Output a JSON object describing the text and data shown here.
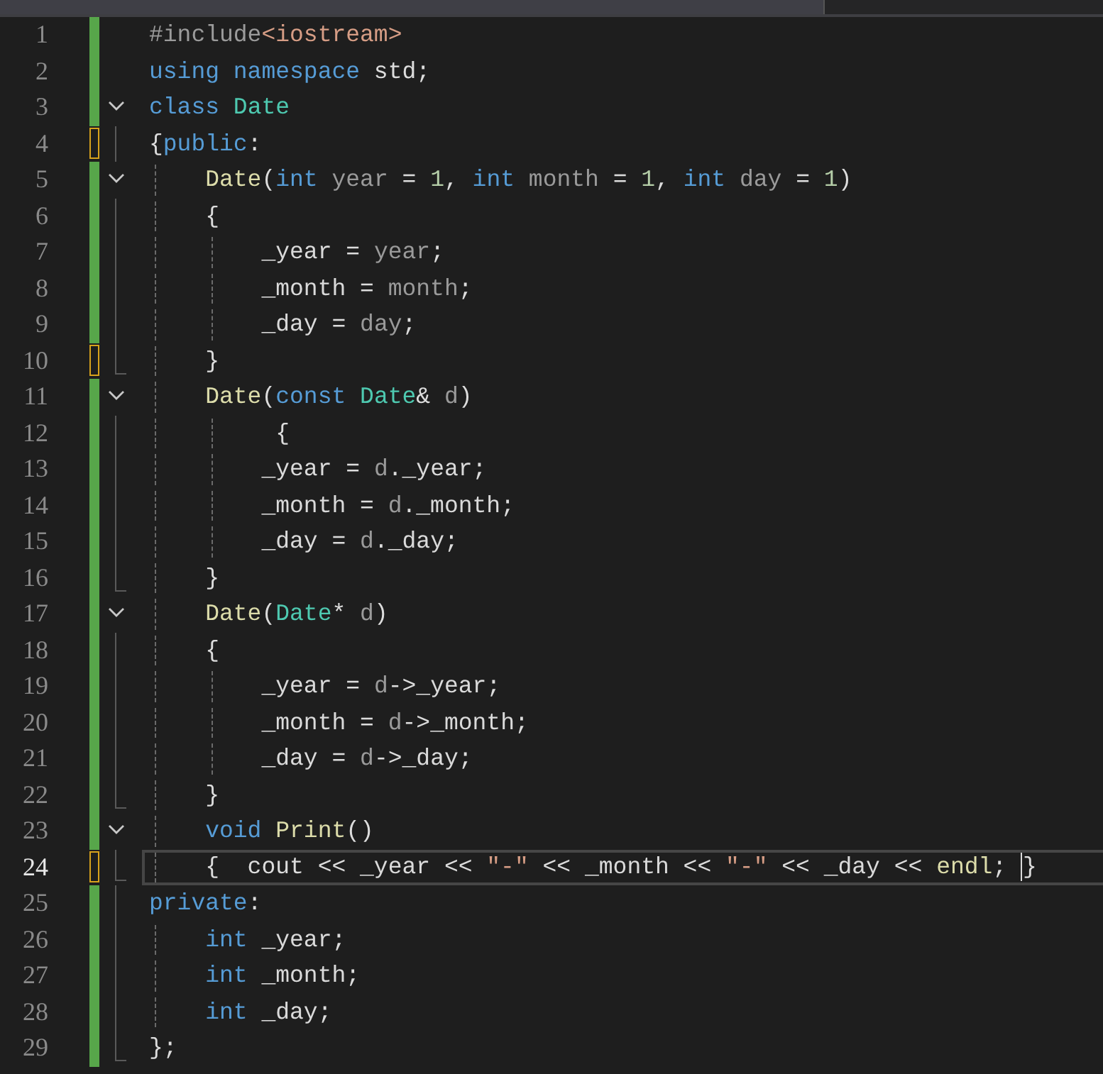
{
  "lines": [
    {
      "number": "1",
      "unsaved": false,
      "foldable": false,
      "in_region": false,
      "region_end": false,
      "current": false,
      "tokens": [
        {
          "kind": "pre",
          "text": "#include"
        },
        {
          "kind": "str",
          "text": "<iostream>"
        }
      ]
    },
    {
      "number": "2",
      "unsaved": false,
      "foldable": false,
      "in_region": false,
      "region_end": false,
      "current": false,
      "tokens": [
        {
          "kind": "kw",
          "text": "using namespace"
        },
        {
          "kind": "plain",
          "text": " std;"
        }
      ]
    },
    {
      "number": "3",
      "unsaved": false,
      "foldable": true,
      "in_region": false,
      "region_end": false,
      "current": false,
      "tokens": [
        {
          "kind": "kw",
          "text": "class"
        },
        {
          "kind": "type",
          "text": " Date"
        }
      ]
    },
    {
      "number": "4",
      "unsaved": true,
      "foldable": false,
      "in_region": true,
      "region_end": false,
      "current": false,
      "tokens": [
        {
          "kind": "plain",
          "text": "{"
        },
        {
          "kind": "kw",
          "text": "public"
        },
        {
          "kind": "plain",
          "text": ":"
        }
      ]
    },
    {
      "number": "5",
      "unsaved": false,
      "foldable": true,
      "in_region": false,
      "region_end": false,
      "current": false,
      "tokens": [
        {
          "kind": "fn",
          "text": "    Date"
        },
        {
          "kind": "plain",
          "text": "("
        },
        {
          "kind": "kw",
          "text": "int"
        },
        {
          "kind": "param",
          "text": " year"
        },
        {
          "kind": "plain",
          "text": " = "
        },
        {
          "kind": "num",
          "text": "1"
        },
        {
          "kind": "plain",
          "text": ", "
        },
        {
          "kind": "kw",
          "text": "int"
        },
        {
          "kind": "param",
          "text": " month"
        },
        {
          "kind": "plain",
          "text": " = "
        },
        {
          "kind": "num",
          "text": "1"
        },
        {
          "kind": "plain",
          "text": ", "
        },
        {
          "kind": "kw",
          "text": "int"
        },
        {
          "kind": "param",
          "text": " day"
        },
        {
          "kind": "plain",
          "text": " = "
        },
        {
          "kind": "num",
          "text": "1"
        },
        {
          "kind": "plain",
          "text": ")"
        }
      ]
    },
    {
      "number": "6",
      "unsaved": false,
      "foldable": false,
      "in_region": true,
      "region_end": false,
      "current": false,
      "tokens": [
        {
          "kind": "plain",
          "text": "    {"
        }
      ]
    },
    {
      "number": "7",
      "unsaved": false,
      "foldable": false,
      "in_region": true,
      "region_end": false,
      "current": false,
      "tokens": [
        {
          "kind": "member",
          "text": "        _year"
        },
        {
          "kind": "plain",
          "text": " = "
        },
        {
          "kind": "param",
          "text": "year"
        },
        {
          "kind": "plain",
          "text": ";"
        }
      ]
    },
    {
      "number": "8",
      "unsaved": false,
      "foldable": false,
      "in_region": true,
      "region_end": false,
      "current": false,
      "tokens": [
        {
          "kind": "member",
          "text": "        _month"
        },
        {
          "kind": "plain",
          "text": " = "
        },
        {
          "kind": "param",
          "text": "month"
        },
        {
          "kind": "plain",
          "text": ";"
        }
      ]
    },
    {
      "number": "9",
      "unsaved": false,
      "foldable": false,
      "in_region": true,
      "region_end": false,
      "current": false,
      "tokens": [
        {
          "kind": "member",
          "text": "        _day"
        },
        {
          "kind": "plain",
          "text": " = "
        },
        {
          "kind": "param",
          "text": "day"
        },
        {
          "kind": "plain",
          "text": ";"
        }
      ]
    },
    {
      "number": "10",
      "unsaved": true,
      "foldable": false,
      "in_region": true,
      "region_end": true,
      "current": false,
      "tokens": [
        {
          "kind": "plain",
          "text": "    }"
        }
      ]
    },
    {
      "number": "11",
      "unsaved": false,
      "foldable": true,
      "in_region": false,
      "region_end": false,
      "current": false,
      "tokens": [
        {
          "kind": "fn",
          "text": "    Date"
        },
        {
          "kind": "plain",
          "text": "("
        },
        {
          "kind": "kw",
          "text": "const"
        },
        {
          "kind": "type",
          "text": " Date"
        },
        {
          "kind": "plain",
          "text": "&"
        },
        {
          "kind": "param",
          "text": " d"
        },
        {
          "kind": "plain",
          "text": ")"
        }
      ]
    },
    {
      "number": "12",
      "unsaved": false,
      "foldable": false,
      "in_region": true,
      "region_end": false,
      "current": false,
      "tokens": [
        {
          "kind": "plain",
          "text": "         {"
        }
      ]
    },
    {
      "number": "13",
      "unsaved": false,
      "foldable": false,
      "in_region": true,
      "region_end": false,
      "current": false,
      "tokens": [
        {
          "kind": "member",
          "text": "        _year"
        },
        {
          "kind": "plain",
          "text": " = "
        },
        {
          "kind": "param",
          "text": "d"
        },
        {
          "kind": "plain",
          "text": "."
        },
        {
          "kind": "member",
          "text": "_year"
        },
        {
          "kind": "plain",
          "text": ";"
        }
      ]
    },
    {
      "number": "14",
      "unsaved": false,
      "foldable": false,
      "in_region": true,
      "region_end": false,
      "current": false,
      "tokens": [
        {
          "kind": "member",
          "text": "        _month"
        },
        {
          "kind": "plain",
          "text": " = "
        },
        {
          "kind": "param",
          "text": "d"
        },
        {
          "kind": "plain",
          "text": "."
        },
        {
          "kind": "member",
          "text": "_month"
        },
        {
          "kind": "plain",
          "text": ";"
        }
      ]
    },
    {
      "number": "15",
      "unsaved": false,
      "foldable": false,
      "in_region": true,
      "region_end": false,
      "current": false,
      "tokens": [
        {
          "kind": "member",
          "text": "        _day"
        },
        {
          "kind": "plain",
          "text": " = "
        },
        {
          "kind": "param",
          "text": "d"
        },
        {
          "kind": "plain",
          "text": "."
        },
        {
          "kind": "member",
          "text": "_day"
        },
        {
          "kind": "plain",
          "text": ";"
        }
      ]
    },
    {
      "number": "16",
      "unsaved": false,
      "foldable": false,
      "in_region": true,
      "region_end": true,
      "current": false,
      "tokens": [
        {
          "kind": "plain",
          "text": "    }"
        }
      ]
    },
    {
      "number": "17",
      "unsaved": false,
      "foldable": true,
      "in_region": false,
      "region_end": false,
      "current": false,
      "tokens": [
        {
          "kind": "fn",
          "text": "    Date"
        },
        {
          "kind": "plain",
          "text": "("
        },
        {
          "kind": "type",
          "text": "Date"
        },
        {
          "kind": "plain",
          "text": "*"
        },
        {
          "kind": "param",
          "text": " d"
        },
        {
          "kind": "plain",
          "text": ")"
        }
      ]
    },
    {
      "number": "18",
      "unsaved": false,
      "foldable": false,
      "in_region": true,
      "region_end": false,
      "current": false,
      "tokens": [
        {
          "kind": "plain",
          "text": "    {"
        }
      ]
    },
    {
      "number": "19",
      "unsaved": false,
      "foldable": false,
      "in_region": true,
      "region_end": false,
      "current": false,
      "tokens": [
        {
          "kind": "member",
          "text": "        _year"
        },
        {
          "kind": "plain",
          "text": " = "
        },
        {
          "kind": "param",
          "text": "d"
        },
        {
          "kind": "plain",
          "text": "->"
        },
        {
          "kind": "member",
          "text": "_year"
        },
        {
          "kind": "plain",
          "text": ";"
        }
      ]
    },
    {
      "number": "20",
      "unsaved": false,
      "foldable": false,
      "in_region": true,
      "region_end": false,
      "current": false,
      "tokens": [
        {
          "kind": "member",
          "text": "        _month"
        },
        {
          "kind": "plain",
          "text": " = "
        },
        {
          "kind": "param",
          "text": "d"
        },
        {
          "kind": "plain",
          "text": "->"
        },
        {
          "kind": "member",
          "text": "_month"
        },
        {
          "kind": "plain",
          "text": ";"
        }
      ]
    },
    {
      "number": "21",
      "unsaved": false,
      "foldable": false,
      "in_region": true,
      "region_end": false,
      "current": false,
      "tokens": [
        {
          "kind": "member",
          "text": "        _day"
        },
        {
          "kind": "plain",
          "text": " = "
        },
        {
          "kind": "param",
          "text": "d"
        },
        {
          "kind": "plain",
          "text": "->"
        },
        {
          "kind": "member",
          "text": "_day"
        },
        {
          "kind": "plain",
          "text": ";"
        }
      ]
    },
    {
      "number": "22",
      "unsaved": false,
      "foldable": false,
      "in_region": true,
      "region_end": true,
      "current": false,
      "tokens": [
        {
          "kind": "plain",
          "text": "    }"
        }
      ]
    },
    {
      "number": "23",
      "unsaved": false,
      "foldable": true,
      "in_region": false,
      "region_end": false,
      "current": false,
      "tokens": [
        {
          "kind": "kw",
          "text": "    void"
        },
        {
          "kind": "fn",
          "text": " Print"
        },
        {
          "kind": "plain",
          "text": "()"
        }
      ]
    },
    {
      "number": "24",
      "unsaved": true,
      "foldable": false,
      "in_region": true,
      "region_end": true,
      "current": true,
      "tokens": [
        {
          "kind": "plain",
          "text": "    {  cout << "
        },
        {
          "kind": "member",
          "text": "_year"
        },
        {
          "kind": "plain",
          "text": " << "
        },
        {
          "kind": "str",
          "text": "\"-\""
        },
        {
          "kind": "plain",
          "text": " << "
        },
        {
          "kind": "member",
          "text": "_month"
        },
        {
          "kind": "plain",
          "text": " << "
        },
        {
          "kind": "str",
          "text": "\"-\""
        },
        {
          "kind": "plain",
          "text": " << "
        },
        {
          "kind": "member",
          "text": "_day"
        },
        {
          "kind": "plain",
          "text": " << "
        },
        {
          "kind": "fn",
          "text": "endl"
        },
        {
          "kind": "plain",
          "text": "; "
        },
        {
          "kind": "plain",
          "text": "}"
        }
      ]
    },
    {
      "number": "25",
      "unsaved": false,
      "foldable": false,
      "in_region": true,
      "region_end": false,
      "current": false,
      "tokens": [
        {
          "kind": "kw",
          "text": "private"
        },
        {
          "kind": "plain",
          "text": ":"
        }
      ]
    },
    {
      "number": "26",
      "unsaved": false,
      "foldable": false,
      "in_region": true,
      "region_end": false,
      "current": false,
      "tokens": [
        {
          "kind": "kw",
          "text": "    int"
        },
        {
          "kind": "member",
          "text": " _year"
        },
        {
          "kind": "plain",
          "text": ";"
        }
      ]
    },
    {
      "number": "27",
      "unsaved": false,
      "foldable": false,
      "in_region": true,
      "region_end": false,
      "current": false,
      "tokens": [
        {
          "kind": "kw",
          "text": "    int"
        },
        {
          "kind": "member",
          "text": " _month"
        },
        {
          "kind": "plain",
          "text": ";"
        }
      ]
    },
    {
      "number": "28",
      "unsaved": false,
      "foldable": false,
      "in_region": true,
      "region_end": false,
      "current": false,
      "tokens": [
        {
          "kind": "kw",
          "text": "    int"
        },
        {
          "kind": "member",
          "text": " _day"
        },
        {
          "kind": "plain",
          "text": ";"
        }
      ]
    },
    {
      "number": "29",
      "unsaved": false,
      "foldable": false,
      "in_region": true,
      "region_end": true,
      "current": false,
      "tokens": [
        {
          "kind": "plain",
          "text": "};"
        }
      ]
    }
  ]
}
